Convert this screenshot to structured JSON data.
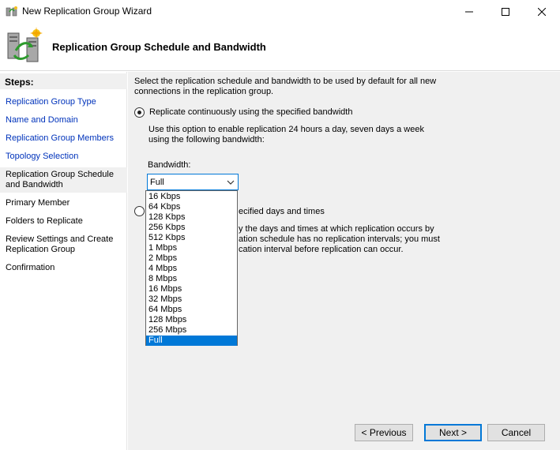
{
  "window": {
    "title": "New Replication Group Wizard"
  },
  "header": {
    "heading": "Replication Group Schedule and Bandwidth"
  },
  "sidebar": {
    "steps_title": "Steps:",
    "items": [
      {
        "label": "Replication Group Type"
      },
      {
        "label": "Name and Domain"
      },
      {
        "label": "Replication Group Members"
      },
      {
        "label": "Topology Selection"
      },
      {
        "line1": "Replication Group Schedule",
        "line2": "and Bandwidth"
      },
      {
        "label": "Primary Member"
      },
      {
        "label": "Folders to Replicate"
      },
      {
        "line1": "Review Settings and Create",
        "line2": "Replication Group"
      },
      {
        "label": "Confirmation"
      }
    ]
  },
  "main": {
    "description_line1": "Select the replication schedule and bandwidth to be used by default for all new",
    "description_line2": "connections in the replication group.",
    "option1": {
      "label": "Replicate continuously using the specified bandwidth",
      "desc_line1": "Use this option to enable replication 24 hours a day, seven days a week",
      "desc_line2": "using the following bandwidth:",
      "bandwidth_label": "Bandwidth:",
      "bandwidth_value": "Full"
    },
    "option2": {
      "label_visible": "ecified days and times",
      "desc_line1": "y the days and times at which replication occurs by",
      "desc_line2": "ation schedule has no replication intervals; you must",
      "desc_line3": "cation interval before replication can occur."
    },
    "bandwidth_options": [
      "16 Kbps",
      "64 Kbps",
      "128 Kbps",
      "256 Kbps",
      "512 Kbps",
      "1 Mbps",
      "2 Mbps",
      "4 Mbps",
      "8 Mbps",
      "16 Mbps",
      "32 Mbps",
      "64 Mbps",
      "128 Mbps",
      "256 Mbps",
      "Full"
    ]
  },
  "buttons": {
    "previous": "< Previous",
    "next": "Next >",
    "cancel": "Cancel"
  }
}
